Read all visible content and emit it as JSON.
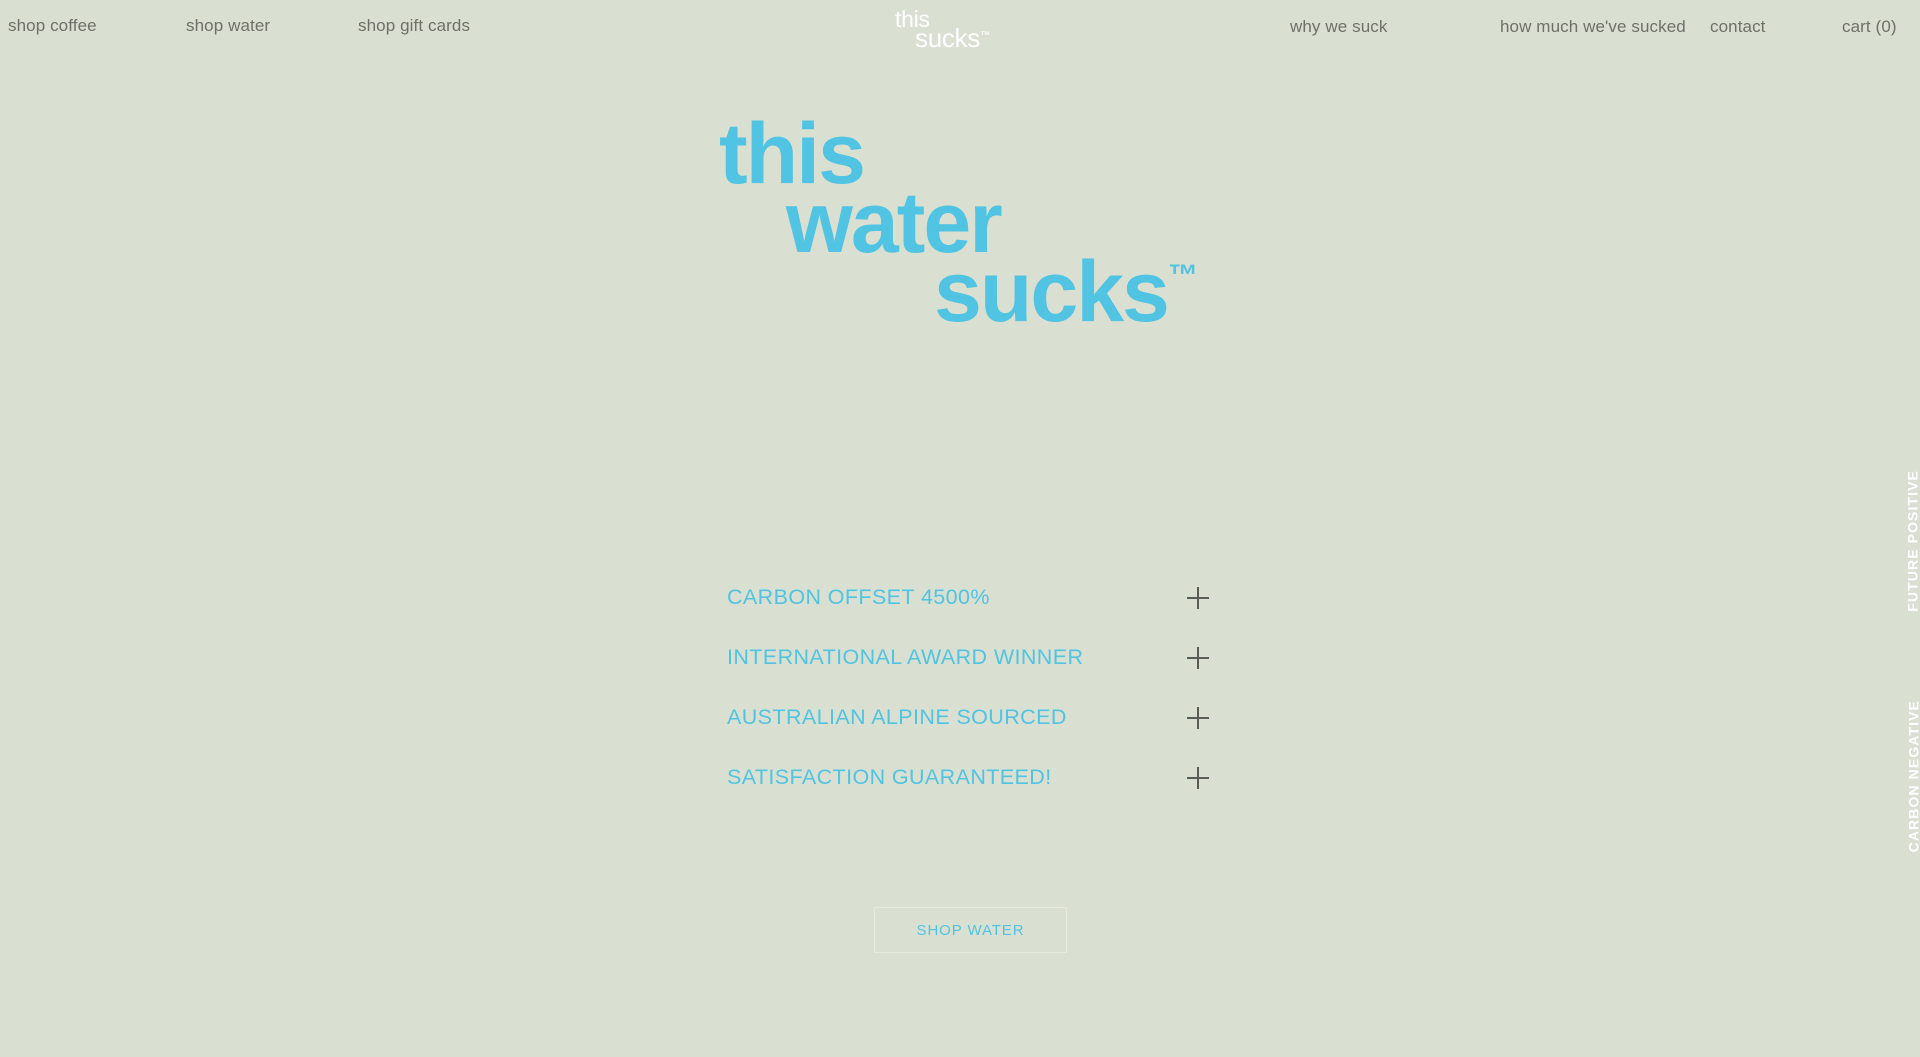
{
  "page": {
    "background_color": "#d9dfd1",
    "accent_color": "#50c4e2",
    "nav_text_color": "#6e7168",
    "white": "#ffffff"
  },
  "header": {
    "nav_left": [
      {
        "label": "shop coffee",
        "name": "nav-shop-coffee"
      },
      {
        "label": "shop water",
        "name": "nav-shop-water"
      },
      {
        "label": "shop gift cards",
        "name": "nav-shop-gift-cards"
      }
    ],
    "logo": {
      "top": "this",
      "bottom": "sucks",
      "tm": "™"
    },
    "nav_right": [
      {
        "label": "why we suck",
        "name": "nav-why-we-suck"
      },
      {
        "label": "how much we've sucked",
        "name": "nav-how-much-weve-sucked"
      },
      {
        "label": "contact",
        "name": "nav-contact"
      },
      {
        "label": "cart (0)",
        "name": "nav-cart"
      }
    ]
  },
  "hero": {
    "line1": "this",
    "line2": "water",
    "line3": "sucks",
    "tm": "™"
  },
  "features": [
    {
      "label": "CARBON OFFSET 4500%",
      "name": "feature-carbon-offset"
    },
    {
      "label": "INTERNATIONAL AWARD WINNER",
      "name": "feature-award-winner"
    },
    {
      "label": "AUSTRALIAN ALPINE SOURCED",
      "name": "feature-alpine-sourced"
    },
    {
      "label": "SATISFACTION GUARANTEED!",
      "name": "feature-satisfaction"
    }
  ],
  "cta": {
    "label": "SHOP WATER"
  },
  "side_labels": {
    "future": "FUTURE POSITIVE",
    "carbon": "CARBON NEGATIVE"
  }
}
